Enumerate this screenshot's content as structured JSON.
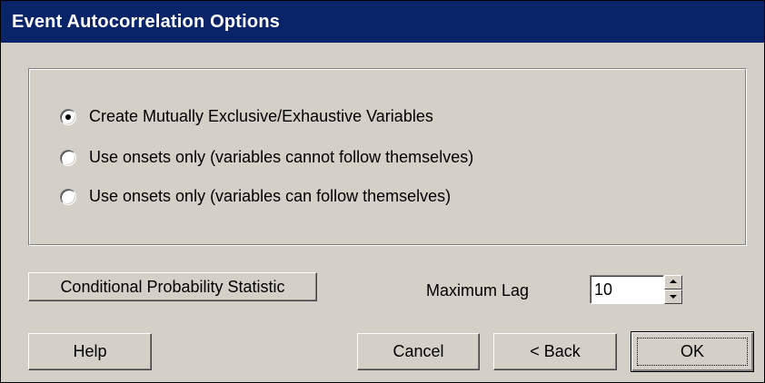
{
  "window": {
    "title": "Event Autocorrelation Options"
  },
  "options": {
    "selected_index": 0,
    "items": [
      {
        "label": "Create Mutually Exclusive/Exhaustive Variables"
      },
      {
        "label": "Use onsets only (variables cannot follow themselves)"
      },
      {
        "label": "Use onsets only (variables can follow themselves)"
      }
    ]
  },
  "statistic_button": {
    "label": "Conditional Probability Statistic"
  },
  "max_lag": {
    "label": "Maximum Lag",
    "value": "10"
  },
  "buttons": {
    "help": "Help",
    "cancel": "Cancel",
    "back": "< Back",
    "ok": "OK"
  }
}
